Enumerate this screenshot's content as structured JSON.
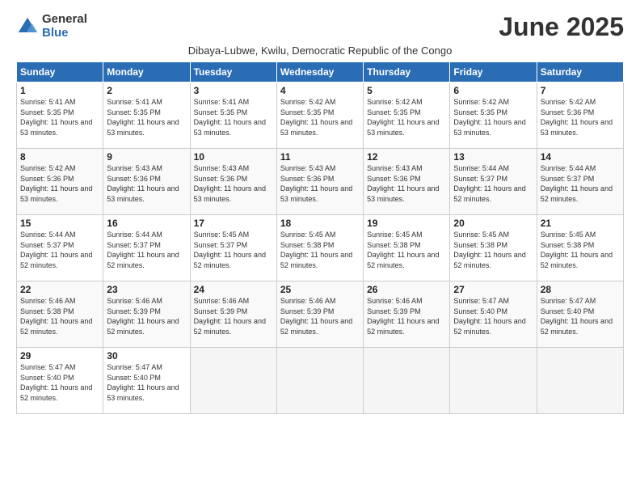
{
  "logo": {
    "general": "General",
    "blue": "Blue"
  },
  "title": "June 2025",
  "subtitle": "Dibaya-Lubwe, Kwilu, Democratic Republic of the Congo",
  "weekdays": [
    "Sunday",
    "Monday",
    "Tuesday",
    "Wednesday",
    "Thursday",
    "Friday",
    "Saturday"
  ],
  "weeks": [
    [
      {
        "day": "1",
        "sunrise": "5:41 AM",
        "sunset": "5:35 PM",
        "daylight": "11 hours and 53 minutes."
      },
      {
        "day": "2",
        "sunrise": "5:41 AM",
        "sunset": "5:35 PM",
        "daylight": "11 hours and 53 minutes."
      },
      {
        "day": "3",
        "sunrise": "5:41 AM",
        "sunset": "5:35 PM",
        "daylight": "11 hours and 53 minutes."
      },
      {
        "day": "4",
        "sunrise": "5:42 AM",
        "sunset": "5:35 PM",
        "daylight": "11 hours and 53 minutes."
      },
      {
        "day": "5",
        "sunrise": "5:42 AM",
        "sunset": "5:35 PM",
        "daylight": "11 hours and 53 minutes."
      },
      {
        "day": "6",
        "sunrise": "5:42 AM",
        "sunset": "5:35 PM",
        "daylight": "11 hours and 53 minutes."
      },
      {
        "day": "7",
        "sunrise": "5:42 AM",
        "sunset": "5:36 PM",
        "daylight": "11 hours and 53 minutes."
      }
    ],
    [
      {
        "day": "8",
        "sunrise": "5:42 AM",
        "sunset": "5:36 PM",
        "daylight": "11 hours and 53 minutes."
      },
      {
        "day": "9",
        "sunrise": "5:43 AM",
        "sunset": "5:36 PM",
        "daylight": "11 hours and 53 minutes."
      },
      {
        "day": "10",
        "sunrise": "5:43 AM",
        "sunset": "5:36 PM",
        "daylight": "11 hours and 53 minutes."
      },
      {
        "day": "11",
        "sunrise": "5:43 AM",
        "sunset": "5:36 PM",
        "daylight": "11 hours and 53 minutes."
      },
      {
        "day": "12",
        "sunrise": "5:43 AM",
        "sunset": "5:36 PM",
        "daylight": "11 hours and 53 minutes."
      },
      {
        "day": "13",
        "sunrise": "5:44 AM",
        "sunset": "5:37 PM",
        "daylight": "11 hours and 52 minutes."
      },
      {
        "day": "14",
        "sunrise": "5:44 AM",
        "sunset": "5:37 PM",
        "daylight": "11 hours and 52 minutes."
      }
    ],
    [
      {
        "day": "15",
        "sunrise": "5:44 AM",
        "sunset": "5:37 PM",
        "daylight": "11 hours and 52 minutes."
      },
      {
        "day": "16",
        "sunrise": "5:44 AM",
        "sunset": "5:37 PM",
        "daylight": "11 hours and 52 minutes."
      },
      {
        "day": "17",
        "sunrise": "5:45 AM",
        "sunset": "5:37 PM",
        "daylight": "11 hours and 52 minutes."
      },
      {
        "day": "18",
        "sunrise": "5:45 AM",
        "sunset": "5:38 PM",
        "daylight": "11 hours and 52 minutes."
      },
      {
        "day": "19",
        "sunrise": "5:45 AM",
        "sunset": "5:38 PM",
        "daylight": "11 hours and 52 minutes."
      },
      {
        "day": "20",
        "sunrise": "5:45 AM",
        "sunset": "5:38 PM",
        "daylight": "11 hours and 52 minutes."
      },
      {
        "day": "21",
        "sunrise": "5:45 AM",
        "sunset": "5:38 PM",
        "daylight": "11 hours and 52 minutes."
      }
    ],
    [
      {
        "day": "22",
        "sunrise": "5:46 AM",
        "sunset": "5:38 PM",
        "daylight": "11 hours and 52 minutes."
      },
      {
        "day": "23",
        "sunrise": "5:46 AM",
        "sunset": "5:39 PM",
        "daylight": "11 hours and 52 minutes."
      },
      {
        "day": "24",
        "sunrise": "5:46 AM",
        "sunset": "5:39 PM",
        "daylight": "11 hours and 52 minutes."
      },
      {
        "day": "25",
        "sunrise": "5:46 AM",
        "sunset": "5:39 PM",
        "daylight": "11 hours and 52 minutes."
      },
      {
        "day": "26",
        "sunrise": "5:46 AM",
        "sunset": "5:39 PM",
        "daylight": "11 hours and 52 minutes."
      },
      {
        "day": "27",
        "sunrise": "5:47 AM",
        "sunset": "5:40 PM",
        "daylight": "11 hours and 52 minutes."
      },
      {
        "day": "28",
        "sunrise": "5:47 AM",
        "sunset": "5:40 PM",
        "daylight": "11 hours and 52 minutes."
      }
    ],
    [
      {
        "day": "29",
        "sunrise": "5:47 AM",
        "sunset": "5:40 PM",
        "daylight": "11 hours and 52 minutes."
      },
      {
        "day": "30",
        "sunrise": "5:47 AM",
        "sunset": "5:40 PM",
        "daylight": "11 hours and 53 minutes."
      },
      null,
      null,
      null,
      null,
      null
    ]
  ],
  "labels": {
    "sunrise": "Sunrise:",
    "sunset": "Sunset:",
    "daylight": "Daylight:"
  }
}
